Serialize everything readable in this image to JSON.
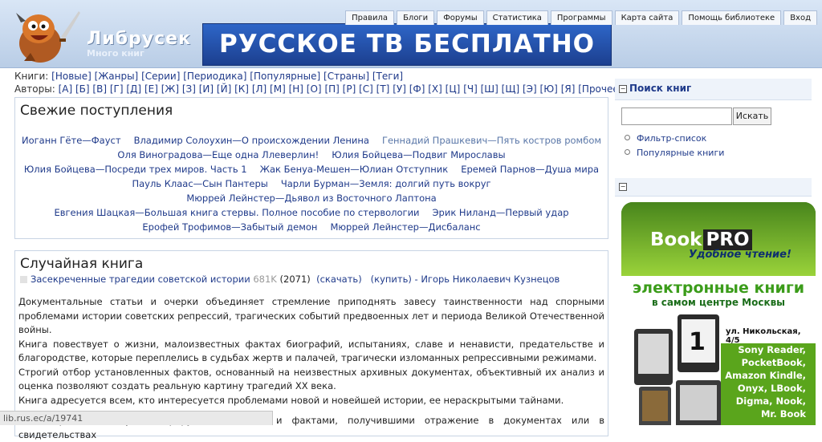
{
  "header": {
    "site_title": "Либрусек",
    "site_subtitle": "Много книг",
    "banner_text": "РУССКОЕ ТВ БЕСПЛАТНО",
    "nav": [
      "Правила",
      "Блоги",
      "Форумы",
      "Статистика",
      "Программы",
      "Карта сайта",
      "Помощь библиотеке",
      "Вход"
    ]
  },
  "links": {
    "books_label": "Книги:",
    "books": [
      "[Новые]",
      "[Жанры]",
      "[Серии]",
      "[Периодика]",
      "[Популярные]",
      "[Страны]",
      "[Теги]"
    ],
    "authors_label": "Авторы:",
    "authors": [
      "[А]",
      "[Б]",
      "[В]",
      "[Г]",
      "[Д]",
      "[Е]",
      "[Ж]",
      "[З]",
      "[И]",
      "[Й]",
      "[К]",
      "[Л]",
      "[М]",
      "[Н]",
      "[О]",
      "[П]",
      "[Р]",
      "[С]",
      "[Т]",
      "[У]",
      "[Ф]",
      "[Х]",
      "[Ц]",
      "[Ч]",
      "[Ш]",
      "[Щ]",
      "[Э]",
      "[Ю]",
      "[Я]",
      "[Прочее]"
    ]
  },
  "fresh": {
    "title": "Свежие поступления",
    "lines": [
      [
        "Иоганн Гёте—Фауст",
        "Владимир Солоухин—О происхождении Ленина",
        "Геннадий Прашкевич—Пять костров ромбом"
      ],
      [
        "Оля Виноградова—Еще одна Ллеверлин!",
        "Юлия Бойцева—Подвиг Мирославы"
      ],
      [
        "Юлия Бойцева—Посреди трех миров. Часть 1",
        "Жак Бенуа-Мешен—Юлиан Отступник",
        "Еремей Парнов—Душа мира"
      ],
      [
        "Пауль Клаас—Сын Пантеры",
        "Чарли Бурман—Земля: долгий путь вокруг"
      ],
      [
        "Мюррей Лейнстер—Дьявол из Восточного Лаптона"
      ],
      [
        "Евгения Шацкая—Большая книга стервы. Полное пособие по стервологии",
        "Эрик Ниланд—Первый удар"
      ],
      [
        "Ерофей Трофимов—Забытый демон",
        "Мюррей Лейнстер—Дисбаланс"
      ]
    ]
  },
  "random": {
    "title": "Случайная книга",
    "book_title": "Засекреченные трагедии советской истории",
    "size": "681K",
    "count": "(2071)",
    "download": "(скачать)",
    "buy": "(купить)",
    "author": "- Игорь Николаевич Кузнецов",
    "paragraphs": [
      "Документальные статьи и очерки объединяет стремление приподнять завесу таинственности над спорными проблемами истории советских репрессий, трагических событий предвоенных лет и периода Великой Отечественной войны.",
      "Книга повествует о жизни, малоизвестных фактах биографий, испытаниях, славе и ненависти, предательстве и благородстве, которые переплелись в судьбах жертв и палачей, трагически изломанных репрессивными режимами.",
      "Строгий отбор установленных фактов, основанный на неизвестных архивных документах, объективный их анализ и оценка позволяют создать реальную картину трагедий XX века.",
      "Книга адресуется всем, кто интересуется проблемами новой и новейшей истории, ее нераскрытыми тайнами."
    ],
    "paragraph_extra": "Историческая наука оперирует событиями и фактами, получившими отражение в документах или в свидетельствах"
  },
  "sidebar": {
    "search_title": "Поиск книг",
    "search_placeholder": "",
    "search_button": "Искать",
    "links": [
      "Фильтр-список",
      "Популярные книги"
    ]
  },
  "ad": {
    "brand": "Book",
    "brand_pro": "PRO",
    "slogan": "Удобное чтение!",
    "title": "электронные книги",
    "subtitle": "в самом центре Москвы",
    "address": "ул. Никольская, 4/5",
    "models": [
      "Sony Reader,",
      "PocketBook,",
      "Amazon Kindle,",
      "Onyx, LBook,",
      "Digma, Nook,",
      "Mr. Book"
    ]
  },
  "status": "lib.rus.ec/a/19741"
}
